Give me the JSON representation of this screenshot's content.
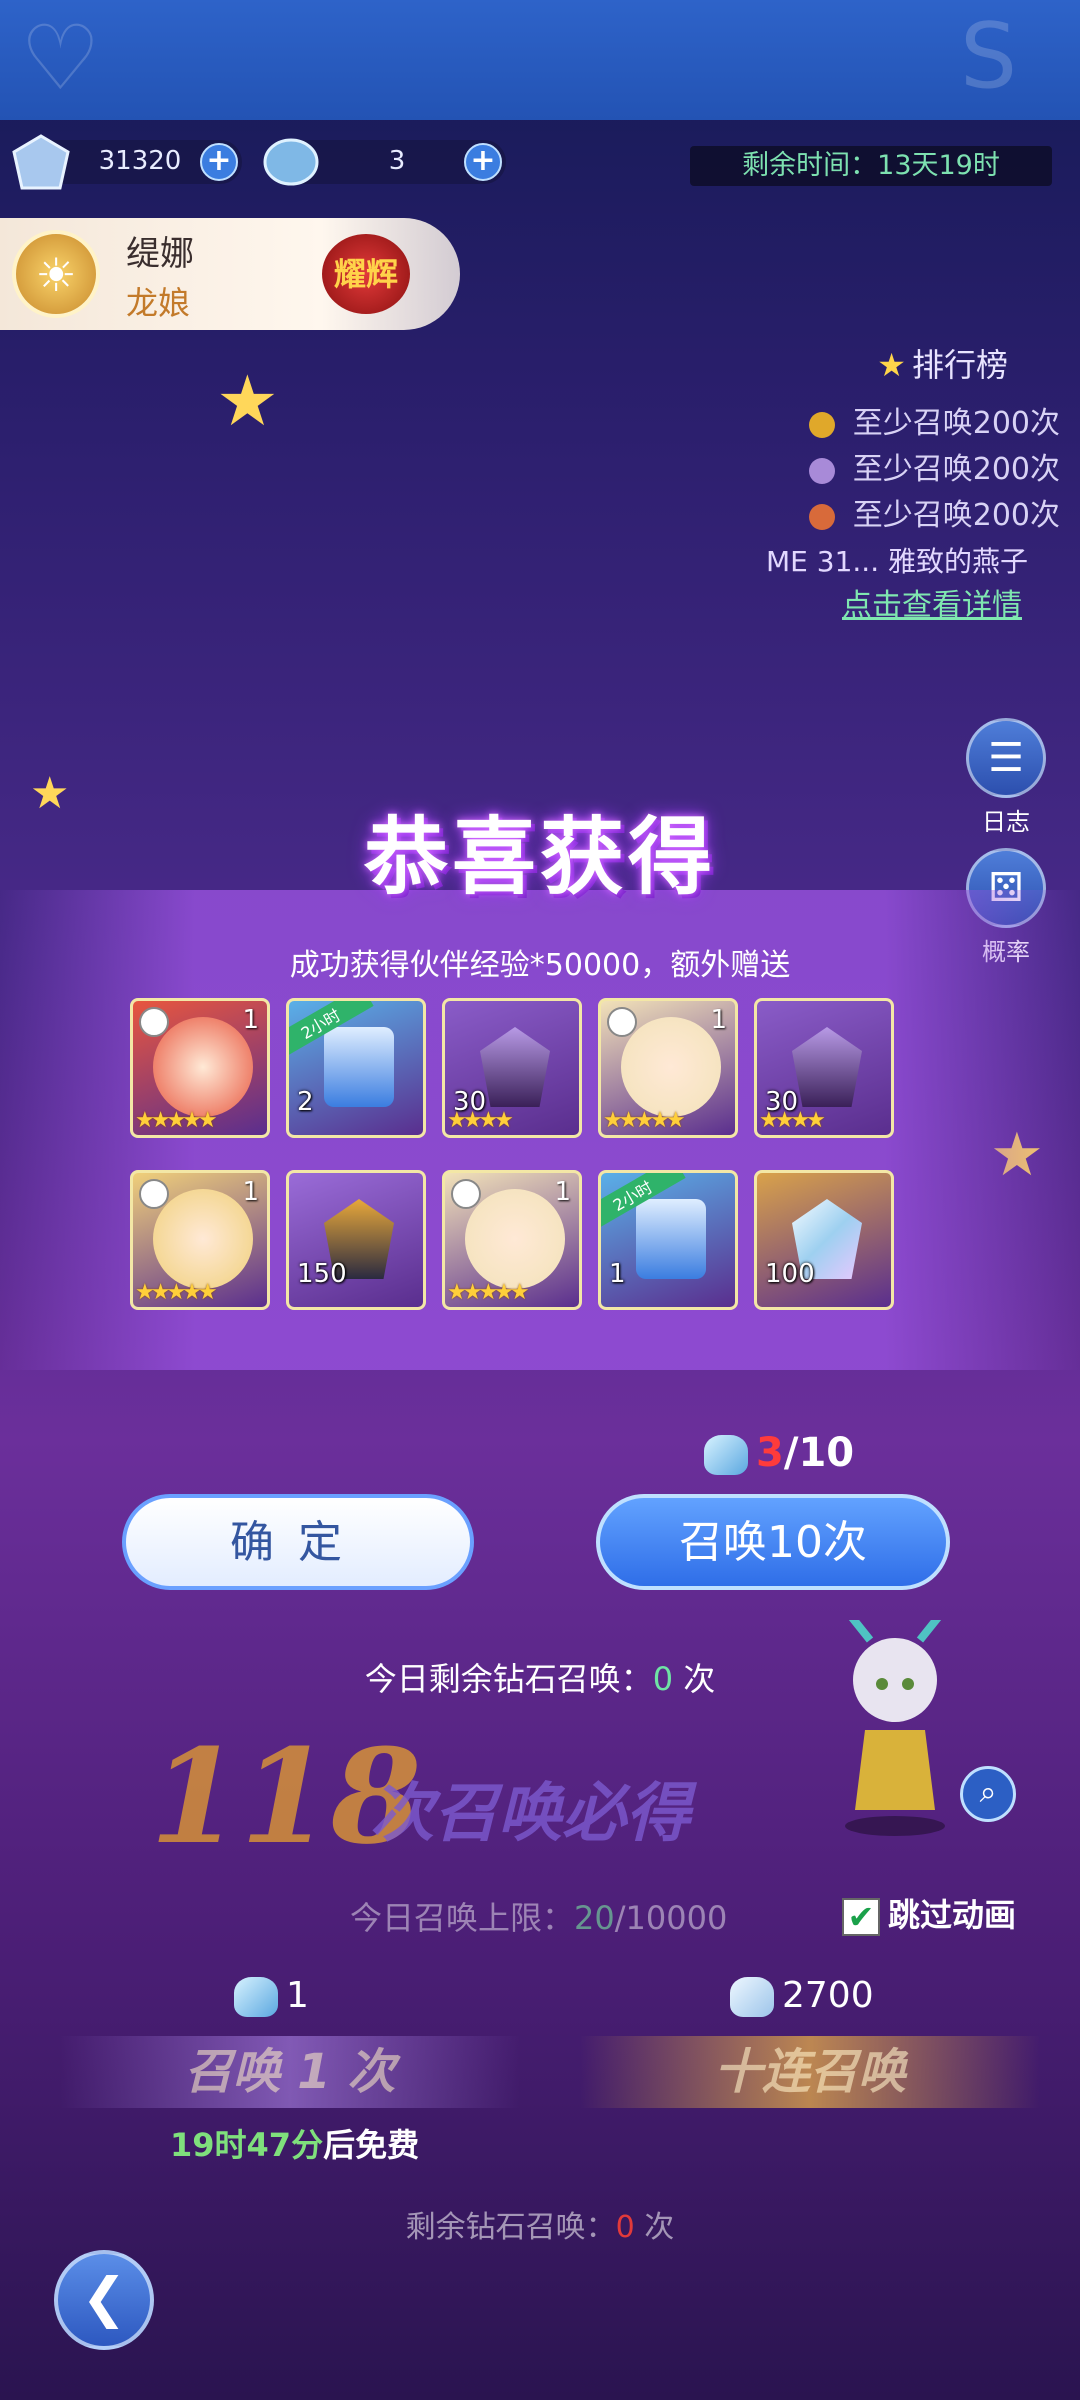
{
  "resources": {
    "crystals": "31320",
    "scales": "3"
  },
  "timer": "剩余时间：13天19时",
  "hero": {
    "name": "缇娜",
    "title": "龙娘",
    "badge": "耀辉"
  },
  "ranking": {
    "title": "排行榜",
    "rows": [
      "至少召唤200次",
      "至少召唤200次",
      "至少召唤200次"
    ],
    "ticker": "ME 31... 雅致的燕子",
    "details_link": "点击查看详情"
  },
  "side_buttons": {
    "log": "日志",
    "probability": "概率"
  },
  "popup": {
    "title": "恭喜获得",
    "subtitle": "成功获得伙伴经验*50000，额外赠送",
    "items": [
      {
        "kind": "hero",
        "count": "1",
        "stars": 5,
        "color": "#e8563e"
      },
      {
        "kind": "chest",
        "count": "2",
        "tag": "2小时",
        "color": "#5ab0e8"
      },
      {
        "kind": "shard",
        "count": "30",
        "stars": 4,
        "color": "#8a5cc8"
      },
      {
        "kind": "hero",
        "count": "1",
        "stars": 5,
        "color": "#f2e2b8"
      },
      {
        "kind": "shard",
        "count": "30",
        "stars": 4,
        "color": "#8a5cc8"
      },
      {
        "kind": "hero",
        "count": "1",
        "stars": 5,
        "color": "#f0d07a"
      },
      {
        "kind": "ore",
        "count": "150",
        "color": "#9a6cd8"
      },
      {
        "kind": "hero",
        "count": "1",
        "stars": 5,
        "color": "#f2e2b8"
      },
      {
        "kind": "chest",
        "count": "1",
        "tag": "2小时",
        "color": "#5ab0e8"
      },
      {
        "kind": "crystal",
        "count": "100",
        "color": "#d9a24a"
      }
    ],
    "counter_current": "3",
    "counter_total": "/10",
    "confirm_label": "确定",
    "summon_ten_label": "召唤10次"
  },
  "remaining_today": {
    "prefix": "今日剩余钻石召唤：",
    "value": "0",
    "suffix": " 次"
  },
  "pity": {
    "number": "118",
    "text": "次召唤必得"
  },
  "daily_limit": {
    "prefix": "今日召唤上限：",
    "value": "20",
    "total": "/10000"
  },
  "skip_animation": "跳过动画",
  "costs": {
    "single": "1",
    "ten": "2700"
  },
  "summon_buttons": {
    "single": "召唤 1 次",
    "ten": "十连召唤"
  },
  "free_timer": {
    "time": "19时47分",
    "suffix": "后免费"
  },
  "diamond_remaining": {
    "prefix": "剩余钻石召唤：",
    "value": "0",
    "suffix": " 次"
  },
  "colors": {
    "accent": "#3b7de0",
    "panel": "#9650dc",
    "green": "#7fe7b0",
    "gold": "#f0a72a"
  }
}
